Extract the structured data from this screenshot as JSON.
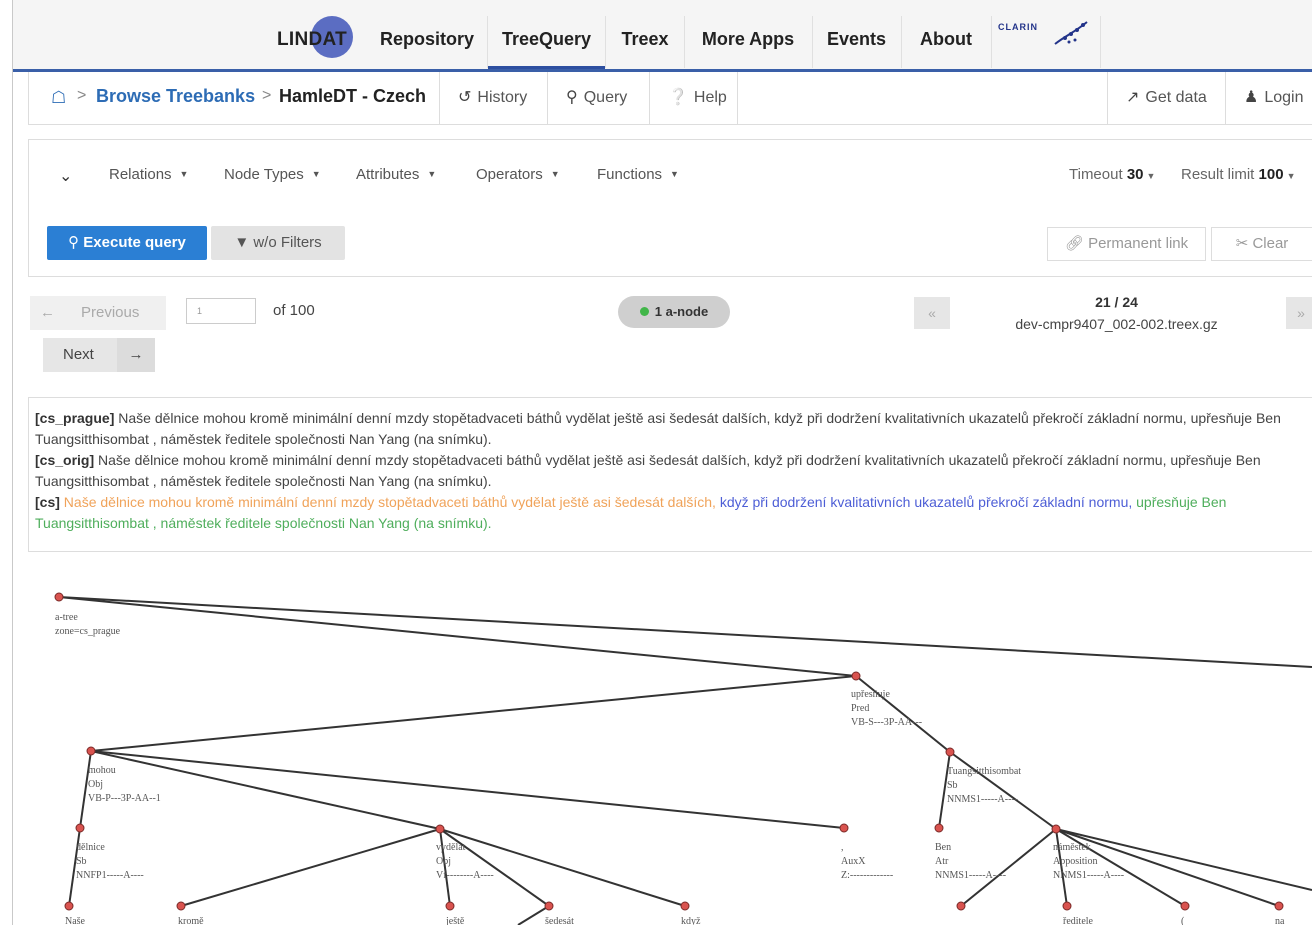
{
  "nav": {
    "logo": "LINDAT",
    "items": [
      "Repository",
      "TreeQuery",
      "Treex",
      "More Apps",
      "Events",
      "About"
    ],
    "active": "TreeQuery",
    "partner": "CLARIN"
  },
  "breadcrumb": {
    "browse": "Browse Treebanks",
    "current": "HamleDT - Czech",
    "tabs": [
      "History",
      "Query",
      "Help"
    ],
    "get_data": "Get data",
    "login": "Login"
  },
  "query": {
    "menus": [
      "Relations",
      "Node Types",
      "Attributes",
      "Operators",
      "Functions"
    ],
    "timeout_label": "Timeout",
    "timeout_value": "30",
    "limit_label": "Result limit",
    "limit_value": "100",
    "execute": "Execute query",
    "wo_filters": "w/o Filters",
    "permanent_link": "Permanent link",
    "clear": "Clear"
  },
  "pager": {
    "previous": "Previous",
    "page_value": "1",
    "of_total": "of 100",
    "next": "Next",
    "badge": "1 a-node",
    "tree_position": "21 / 24",
    "file": "dev-cmpr9407_002-002.treex.gz"
  },
  "sentences": {
    "s1_zone": "[cs_prague]",
    "s1_text": "Naše dělnice mohou kromě minimální denní mzdy stopětadvaceti báthů vydělat ještě asi šedesát dalších, když při dodržení kvalitativních ukazatelů překročí základní normu, upřesňuje Ben Tuangsitthisombat , náměstek ředitele společnosti Nan Yang (na snímku).",
    "s2_zone": "[cs_orig]",
    "s2_text": "Naše dělnice mohou kromě minimální denní mzdy stopětadvaceti báthů vydělat ještě asi šedesát dalších, když při dodržení kvalitativních ukazatelů překročí základní normu, upřesňuje Ben Tuangsitthisombat , náměstek ředitele společnosti Nan Yang (na snímku).",
    "s3_zone": "[cs]",
    "s3_part1": "Naše dělnice mohou kromě minimální denní mzdy stopětadvaceti báthů vydělat ještě asi šedesát dalších,",
    "s3_part2": "když při dodržení kvalitativních ukazatelů překročí základní normu,",
    "s3_part3": "upřesňuje Ben Tuangsitthisombat , náměstek ředitele společnosti Nan Yang (na snímku).",
    "colors": {
      "part1": "#f0a35a",
      "part2": "#4d5ed6",
      "part3": "#4fae5c"
    }
  },
  "tree": {
    "root_l1": "a-tree",
    "root_l2": "zone=cs_prague",
    "nodes": [
      {
        "id": "upresnuje",
        "l1": "upřesňuje",
        "l2": "Pred",
        "l3": "VB-S---3P-AA---"
      },
      {
        "id": "mohou",
        "l1": "mohou",
        "l2": "Obj",
        "l3": "VB-P---3P-AA--1"
      },
      {
        "id": "tuang",
        "l1": "Tuangsitthisombat",
        "l2": "Sb",
        "l3": "NNMS1-----A----"
      },
      {
        "id": "delnice",
        "l1": "dělnice",
        "l2": "Sb",
        "l3": "NNFP1-----A----"
      },
      {
        "id": "vydelat",
        "l1": "vydělat",
        "l2": "Obj",
        "l3": "Vf--------A----"
      },
      {
        "id": "comma",
        "l1": ",",
        "l2": "AuxX",
        "l3": "Z:-------------"
      },
      {
        "id": "ben",
        "l1": "Ben",
        "l2": "Atr",
        "l3": "NNMS1-----A----"
      },
      {
        "id": "namestek",
        "l1": "náměstek",
        "l2": "Apposition",
        "l3": "NNMS1-----A----"
      },
      {
        "id": "nase",
        "l1": "Naše"
      },
      {
        "id": "krome",
        "l1": "kromě"
      },
      {
        "id": "jeste",
        "l1": "ještě"
      },
      {
        "id": "sedesat",
        "l1": "šedesát"
      },
      {
        "id": "kdyz",
        "l1": "když"
      },
      {
        "id": "reditele",
        "l1": "ředitele"
      },
      {
        "id": "paren",
        "l1": "("
      },
      {
        "id": "na",
        "l1": "na"
      }
    ]
  }
}
